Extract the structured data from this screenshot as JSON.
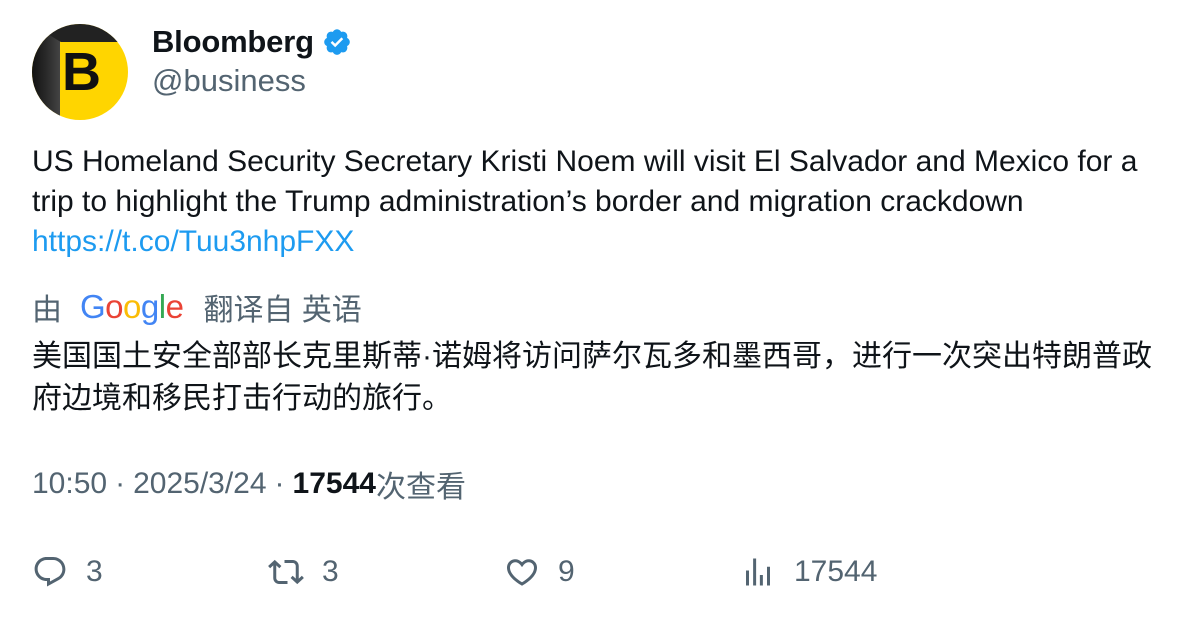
{
  "author": {
    "display_name": "Bloomberg",
    "handle": "@business",
    "avatar_letter": "B",
    "verified": true,
    "avatar_color": "#ffd500",
    "verified_color": "#1d9bf0"
  },
  "tweet": {
    "text": "US Homeland Security Secretary Kristi Noem will visit El Salvador and Mexico for a trip to highlight the Trump administration’s border and migration crackdown",
    "link": "https://t.co/Tuu3nhpFXX"
  },
  "translation": {
    "prefix": "由",
    "provider_letters": [
      "G",
      "o",
      "o",
      "g",
      "l",
      "e"
    ],
    "suffix": "翻译自 英语",
    "text": "美国国土安全部部长克里斯蒂·诺姆将访问萨尔瓦多和墨西哥，进行一次突出特朗普政府边境和移民打击行动的旅行。"
  },
  "meta": {
    "time": "10:50",
    "separator": "·",
    "date": "2025/3/24",
    "views_count": "17544",
    "views_label": "次查看"
  },
  "actions": {
    "reply_icon": "reply-icon",
    "reply_count": "3",
    "retweet_icon": "retweet-icon",
    "retweet_count": "3",
    "like_icon": "heart-icon",
    "like_count": "9",
    "views_icon": "views-chart-icon",
    "views_count": "17544"
  },
  "colors": {
    "text_primary": "#0f1419",
    "text_secondary": "#536471",
    "link": "#1d9bf0"
  }
}
